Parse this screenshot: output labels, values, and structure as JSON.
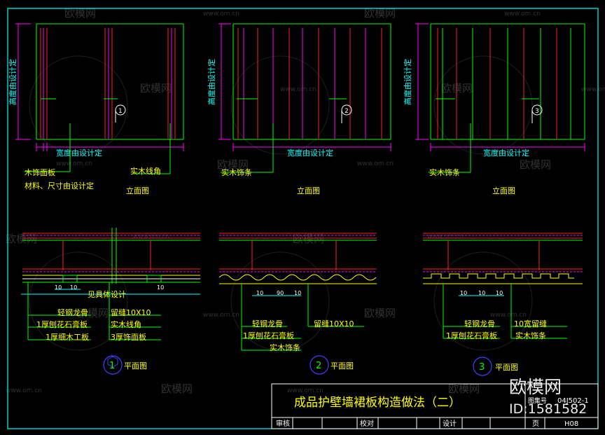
{
  "title": "成品护壁墙裙板构造做法（二）",
  "watermark": {
    "brand": "欧模网",
    "url": "www.om.cn",
    "logo": "欧模网",
    "id_text": "ID:1581582"
  },
  "elevations": {
    "caption": "立面图",
    "height_dim": "高度由设计定",
    "width_dim": "宽度由设计定",
    "e1": {
      "callout_num": "1",
      "label_1": "木饰面板",
      "label_2": "材料、尺寸由设计定",
      "label_3": "实木线角"
    },
    "e2": {
      "callout_num": "2",
      "label_1": "实木饰条"
    },
    "e3": {
      "callout_num": "3",
      "label_1": "实木饰条"
    }
  },
  "plans": {
    "caption": "平面图",
    "p1": {
      "num": "1",
      "note": "见具体设计",
      "dims": [
        "10",
        "10",
        "10"
      ],
      "labels": [
        "轻钢龙骨",
        "1厚刨花石膏板",
        "1厚细木工板",
        "留缝10X10",
        "实木线角",
        "3厚饰面板"
      ]
    },
    "p2": {
      "num": "2",
      "dims": [
        "10",
        "90",
        "10"
      ],
      "labels": [
        "轻钢龙骨",
        "1厚刨花石膏板",
        "实木饰条",
        "留缝10X10"
      ]
    },
    "p3": {
      "num": "3",
      "dims": [
        "10",
        "10",
        "10"
      ],
      "labels": [
        "轻钢龙骨",
        "1厚刨花石膏板",
        "10宽留缝",
        "实木饰条"
      ]
    }
  },
  "title_block": {
    "atlas_label": "图集号",
    "atlas_no": "04J502-1",
    "cells": [
      "审核",
      "校对",
      "设计",
      "页"
    ],
    "page": "H08"
  },
  "colors": {
    "frame": "#00ffff",
    "green": "#00ff00",
    "red": "#ff2020",
    "magenta": "#ff00ff",
    "yellow": "#ffff00",
    "white": "#ffffff",
    "blue": "#4040ff",
    "title": "#ffff00"
  }
}
